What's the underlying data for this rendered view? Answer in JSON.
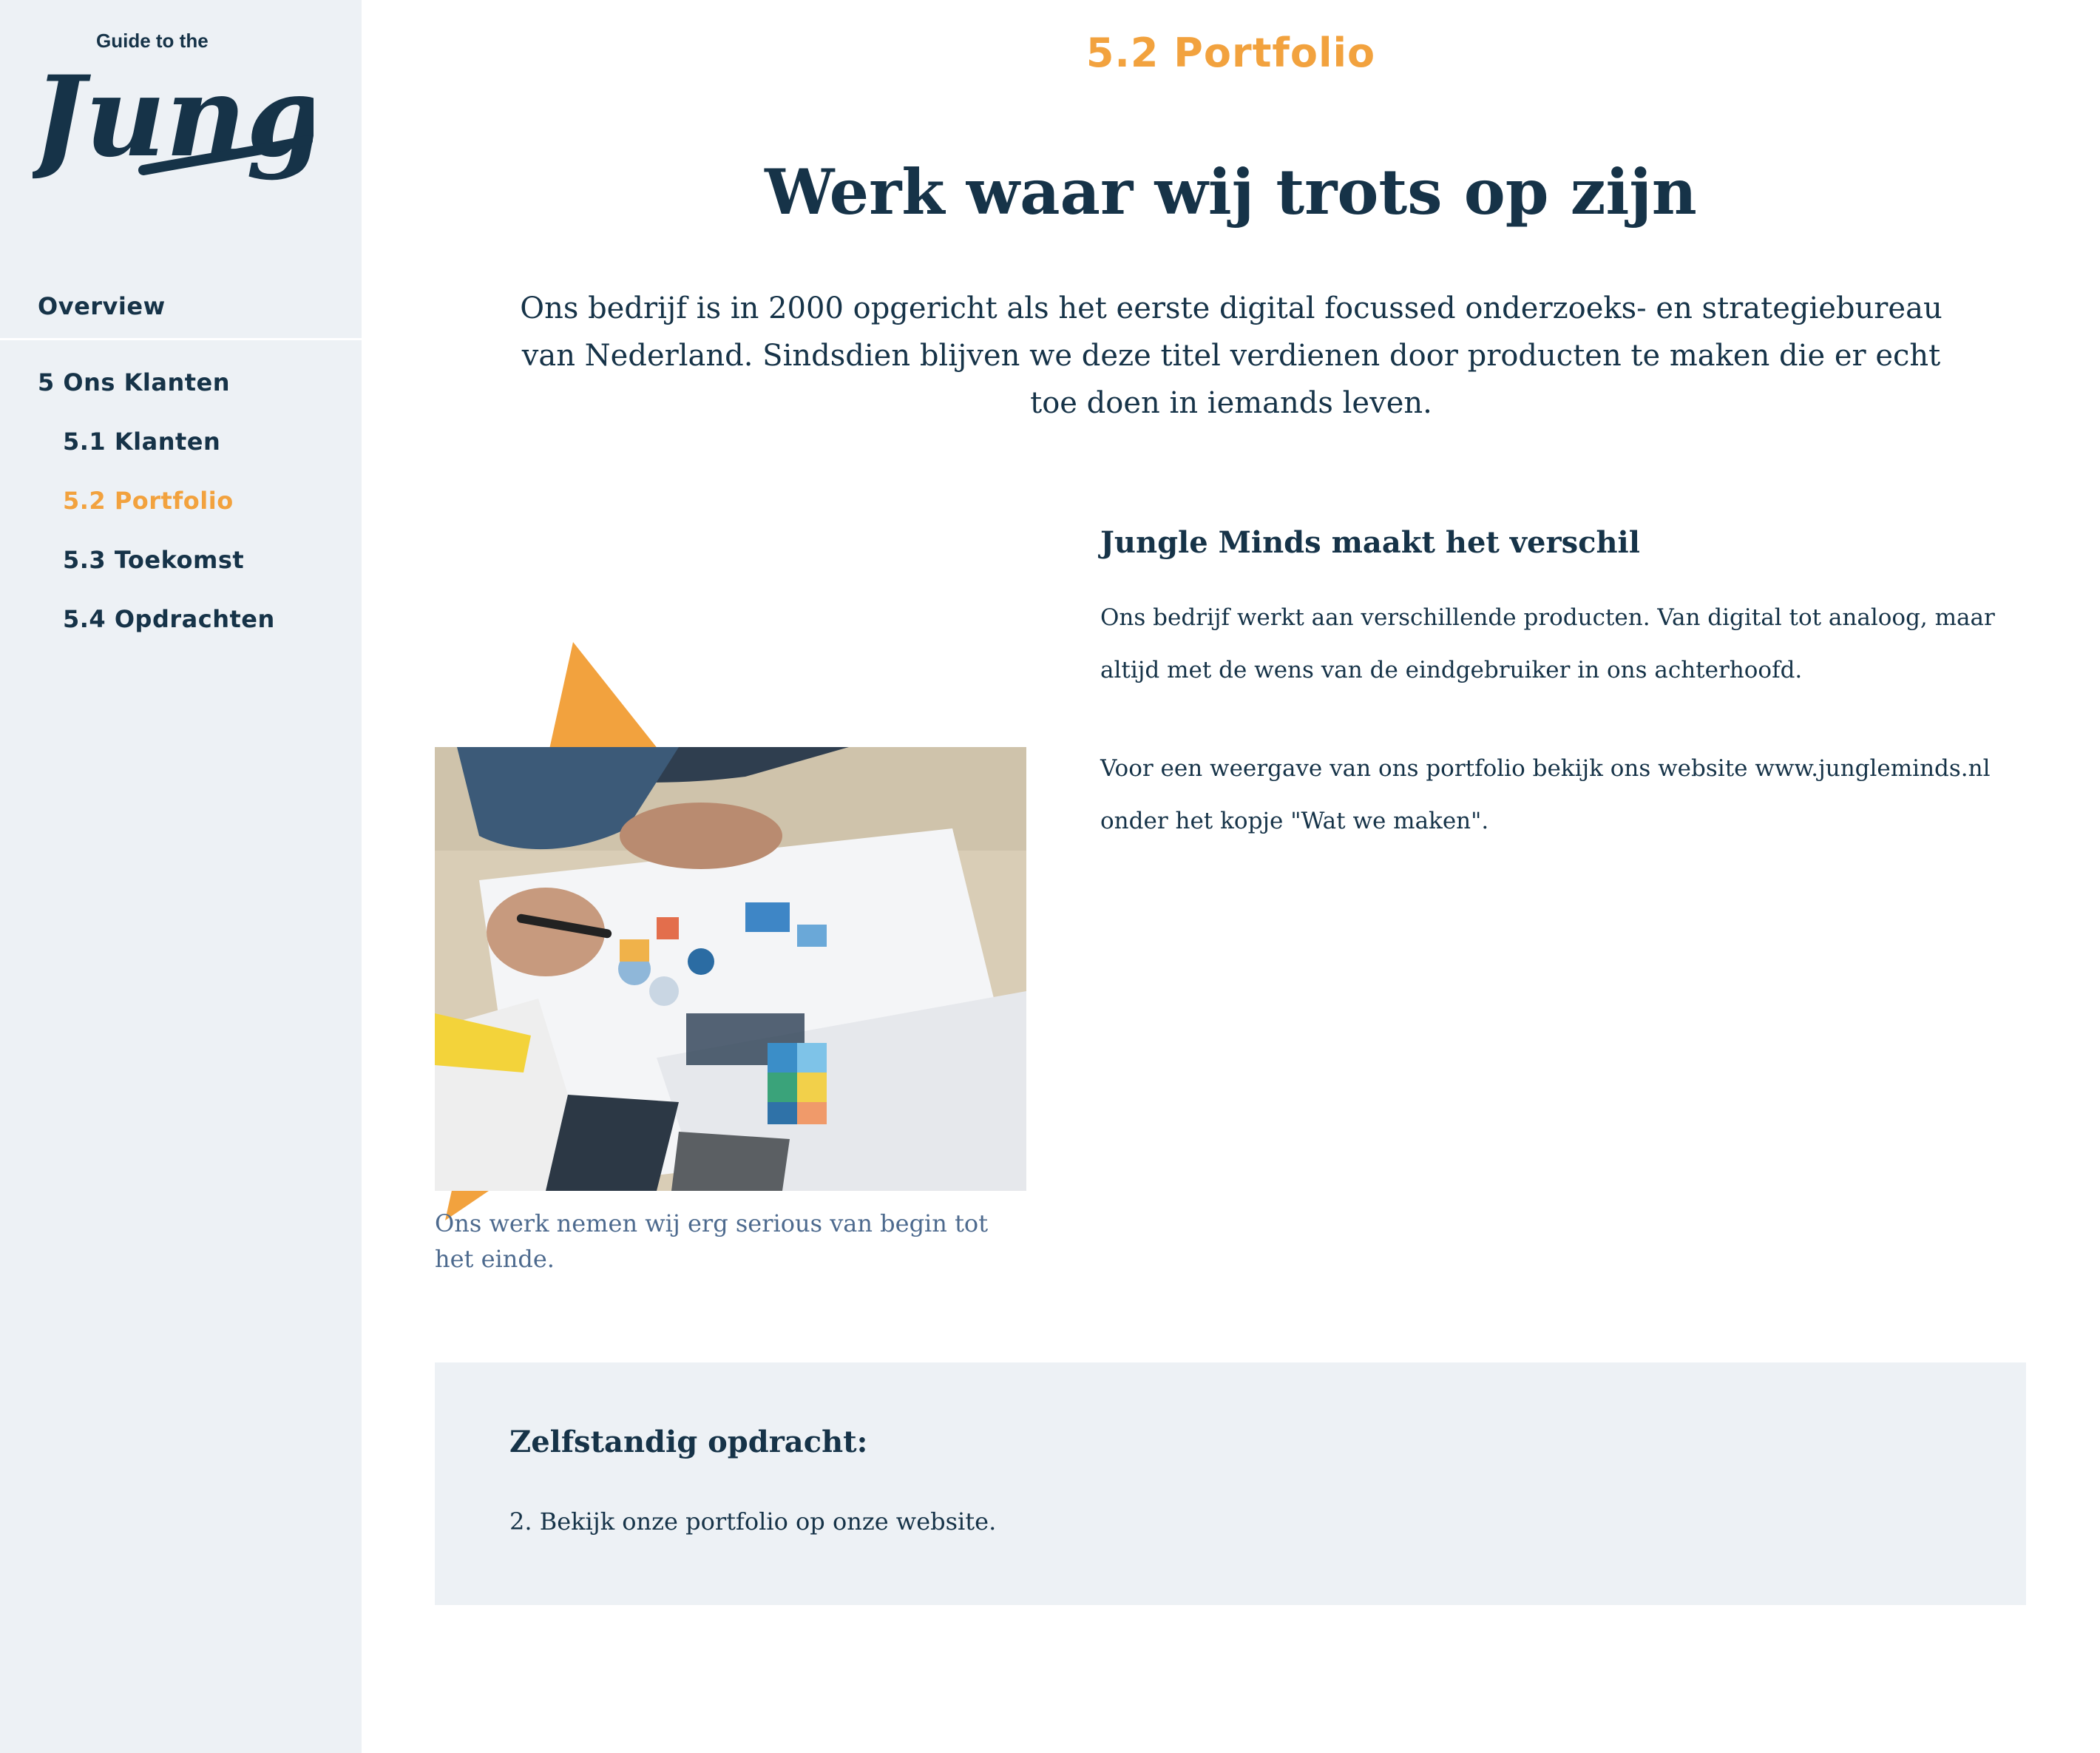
{
  "logo": {
    "small_text": "Guide to the",
    "script_text": "Jungle"
  },
  "nav": {
    "overview": "Overview",
    "chapter": "5 Ons Klanten",
    "items": [
      {
        "label": "5.1 Klanten"
      },
      {
        "label": "5.2 Portfolio",
        "active": true
      },
      {
        "label": "5.3 Toekomst"
      },
      {
        "label": "5.4 Opdrachten"
      }
    ]
  },
  "page": {
    "kicker": "5.2 Portfolio",
    "title": "Werk waar wij trots op zijn",
    "intro": "Ons bedrijf is in 2000 opgericht als het eerste digital focussed onderzoeks- en strategiebureau van Nederland. Sindsdien blijven we deze titel verdienen door producten te maken die er echt toe doen in iemands leven."
  },
  "figure": {
    "caption": "Ons werk nemen wij erg serious van begin tot het einde."
  },
  "section": {
    "heading": "Jungle Minds maakt het verschil",
    "paragraph1": "Ons bedrijf werkt aan verschillende producten. Van digital tot analoog, maar altijd met de wens van de eindgebruiker in ons achterhoofd.",
    "paragraph2": "Voor een weergave van ons portfolio bekijk ons website www.jungleminds.nl onder het kopje \"Wat we maken\"."
  },
  "assignment": {
    "title": "Zelfstandig opdracht:",
    "text": "2. Bekijk onze portfolio op onze website."
  },
  "colors": {
    "accent": "#f2a23e",
    "navy": "#163348",
    "sidebar_bg": "#edf1f5",
    "caption": "#4d6a8e"
  }
}
